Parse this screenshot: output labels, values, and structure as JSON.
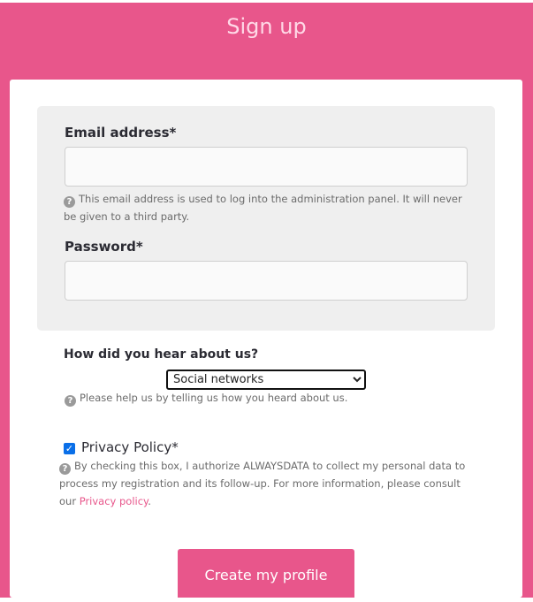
{
  "header": {
    "title": "Sign up"
  },
  "form": {
    "email": {
      "label": "Email address*",
      "value": "",
      "placeholder": "",
      "help": "This email address is used to log into the administration panel. It will never be given to a third party."
    },
    "password": {
      "label": "Password*",
      "value": "",
      "placeholder": ""
    },
    "source": {
      "label": "How did you hear about us?",
      "selected": "Social networks",
      "help": "Please help us by telling us how you heard about us."
    },
    "privacy": {
      "label": "Privacy Policy*",
      "checked": true,
      "help_text": "By checking this box, I authorize ALWAYSDATA to collect my personal data to process my registration and its follow-up. For more information, please consult our",
      "link_text": "Privacy policy",
      "suffix": "."
    },
    "submit_label": "Create my profile"
  },
  "colors": {
    "brand": "#e8568b",
    "card": "#ffffff",
    "panel": "#efefef"
  },
  "icons": {
    "help": "question-circle-icon",
    "checkbox": "checkmark-icon"
  }
}
